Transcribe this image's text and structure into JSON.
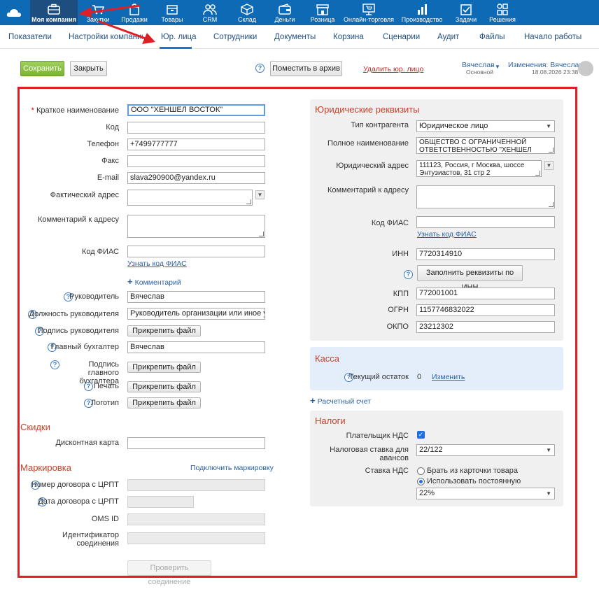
{
  "topnav": {
    "items": [
      {
        "label": "Моя компания",
        "icon": "briefcase-icon"
      },
      {
        "label": "Закупки",
        "icon": "cart-icon"
      },
      {
        "label": "Продажи",
        "icon": "bag-icon"
      },
      {
        "label": "Товары",
        "icon": "box-icon"
      },
      {
        "label": "CRM",
        "icon": "people-icon"
      },
      {
        "label": "Склад",
        "icon": "cube-icon"
      },
      {
        "label": "Деньги",
        "icon": "wallet-icon"
      },
      {
        "label": "Розница",
        "icon": "store-icon"
      },
      {
        "label": "Онлайн-торговля",
        "icon": "cart-screen-icon"
      },
      {
        "label": "Производство",
        "icon": "bars-icon"
      },
      {
        "label": "Задачи",
        "icon": "check-icon"
      },
      {
        "label": "Решения",
        "icon": "grid-icon"
      }
    ]
  },
  "tabs": [
    "Показатели",
    "Настройки компании",
    "Юр. лица",
    "Сотрудники",
    "Документы",
    "Корзина",
    "Сценарии",
    "Аудит",
    "Файлы",
    "Начало работы"
  ],
  "toolbar": {
    "save": "Сохранить",
    "close": "Закрыть",
    "archive": "Поместить в архив",
    "delete": "Удалить юр. лицо",
    "user": "Вячеслав",
    "user_group": "Основной",
    "changes_label": "Изменения: Вячеслав",
    "changes_date": "18.08.2026 23:38"
  },
  "left": {
    "short_name_label": "Краткое наименование",
    "short_name": "ООО \"ХЕНШЕЛ ВОСТОК\"",
    "code_label": "Код",
    "code": "",
    "phone_label": "Телефон",
    "phone": "+7499777777",
    "fax_label": "Факс",
    "fax": "",
    "email_label": "E-mail",
    "email": "slava290900@yandex.ru",
    "actual_address_label": "Фактический адрес",
    "actual_address": "",
    "address_comment_label": "Комментарий к адресу",
    "address_comment": "",
    "fias_label": "Код ФИАС",
    "fias": "",
    "fias_link": "Узнать код ФИАС",
    "comment_link": "Комментарий",
    "head_label": "Руководитель",
    "head": "Вячеслав",
    "head_position_label": "Должность руководителя",
    "head_position": "Руководитель организации или иное уполномоч",
    "head_sign_label": "Подпись руководителя",
    "attach": "Прикрепить файл",
    "chief_acc_label": "Главный бухгалтер",
    "chief_acc": "Вячеслав",
    "chief_acc_sign_label": "Подпись главного бухгалтера",
    "stamp_label": "Печать",
    "logo_label": "Логотип",
    "discounts_title": "Скидки",
    "discount_card_label": "Дисконтная карта",
    "discount_card": "",
    "marking_title": "Маркировка",
    "marking_link": "Подключить маркировку",
    "crpt_contract_label": "Номер договора с ЦРПТ",
    "crpt_date_label": "Дата договора с ЦРПТ",
    "oms_label": "OMS ID",
    "conn_id_label": "Идентификатор соединения",
    "check_conn": "Проверить соединение"
  },
  "right": {
    "legal_title": "Юридические реквизиты",
    "type_label": "Тип контрагента",
    "type": "Юридическое лицо",
    "full_name_label": "Полное наименование",
    "full_name": "ОБЩЕСТВО С ОГРАНИЧЕННОЙ ОТВЕТСТВЕННОСТЬЮ \"ХЕНШЕЛ ВОСТОК\"",
    "legal_address_label": "Юридический адрес",
    "legal_address": "111123, Россия, г Москва, шоссе Энтузиастов, 31 стр 2",
    "address_comment_label": "Комментарий к адресу",
    "address_comment": "",
    "fias_label": "Код ФИАС",
    "fias": "",
    "fias_link": "Узнать код ФИАС",
    "inn_label": "ИНН",
    "inn": "7720314910",
    "fill_by_inn": "Заполнить реквизиты по ИНН",
    "kpp_label": "КПП",
    "kpp": "772001001",
    "ogrn_label": "ОГРН",
    "ogrn": "1157746832022",
    "okpo_label": "ОКПО",
    "okpo": "23212302",
    "cash_title": "Касса",
    "balance_label": "Текущий остаток",
    "balance": "0",
    "change_link": "Изменить",
    "account_link": "Расчетный счет",
    "tax_title": "Налоги",
    "vat_payer_label": "Плательщик НДС",
    "advance_rate_label": "Налоговая ставка для авансов",
    "advance_rate": "22/122",
    "vat_rate_label": "Ставка НДС",
    "vat_opt1": "Брать из карточки товара",
    "vat_opt2": "Использовать постоянную",
    "vat_rate": "22%"
  }
}
